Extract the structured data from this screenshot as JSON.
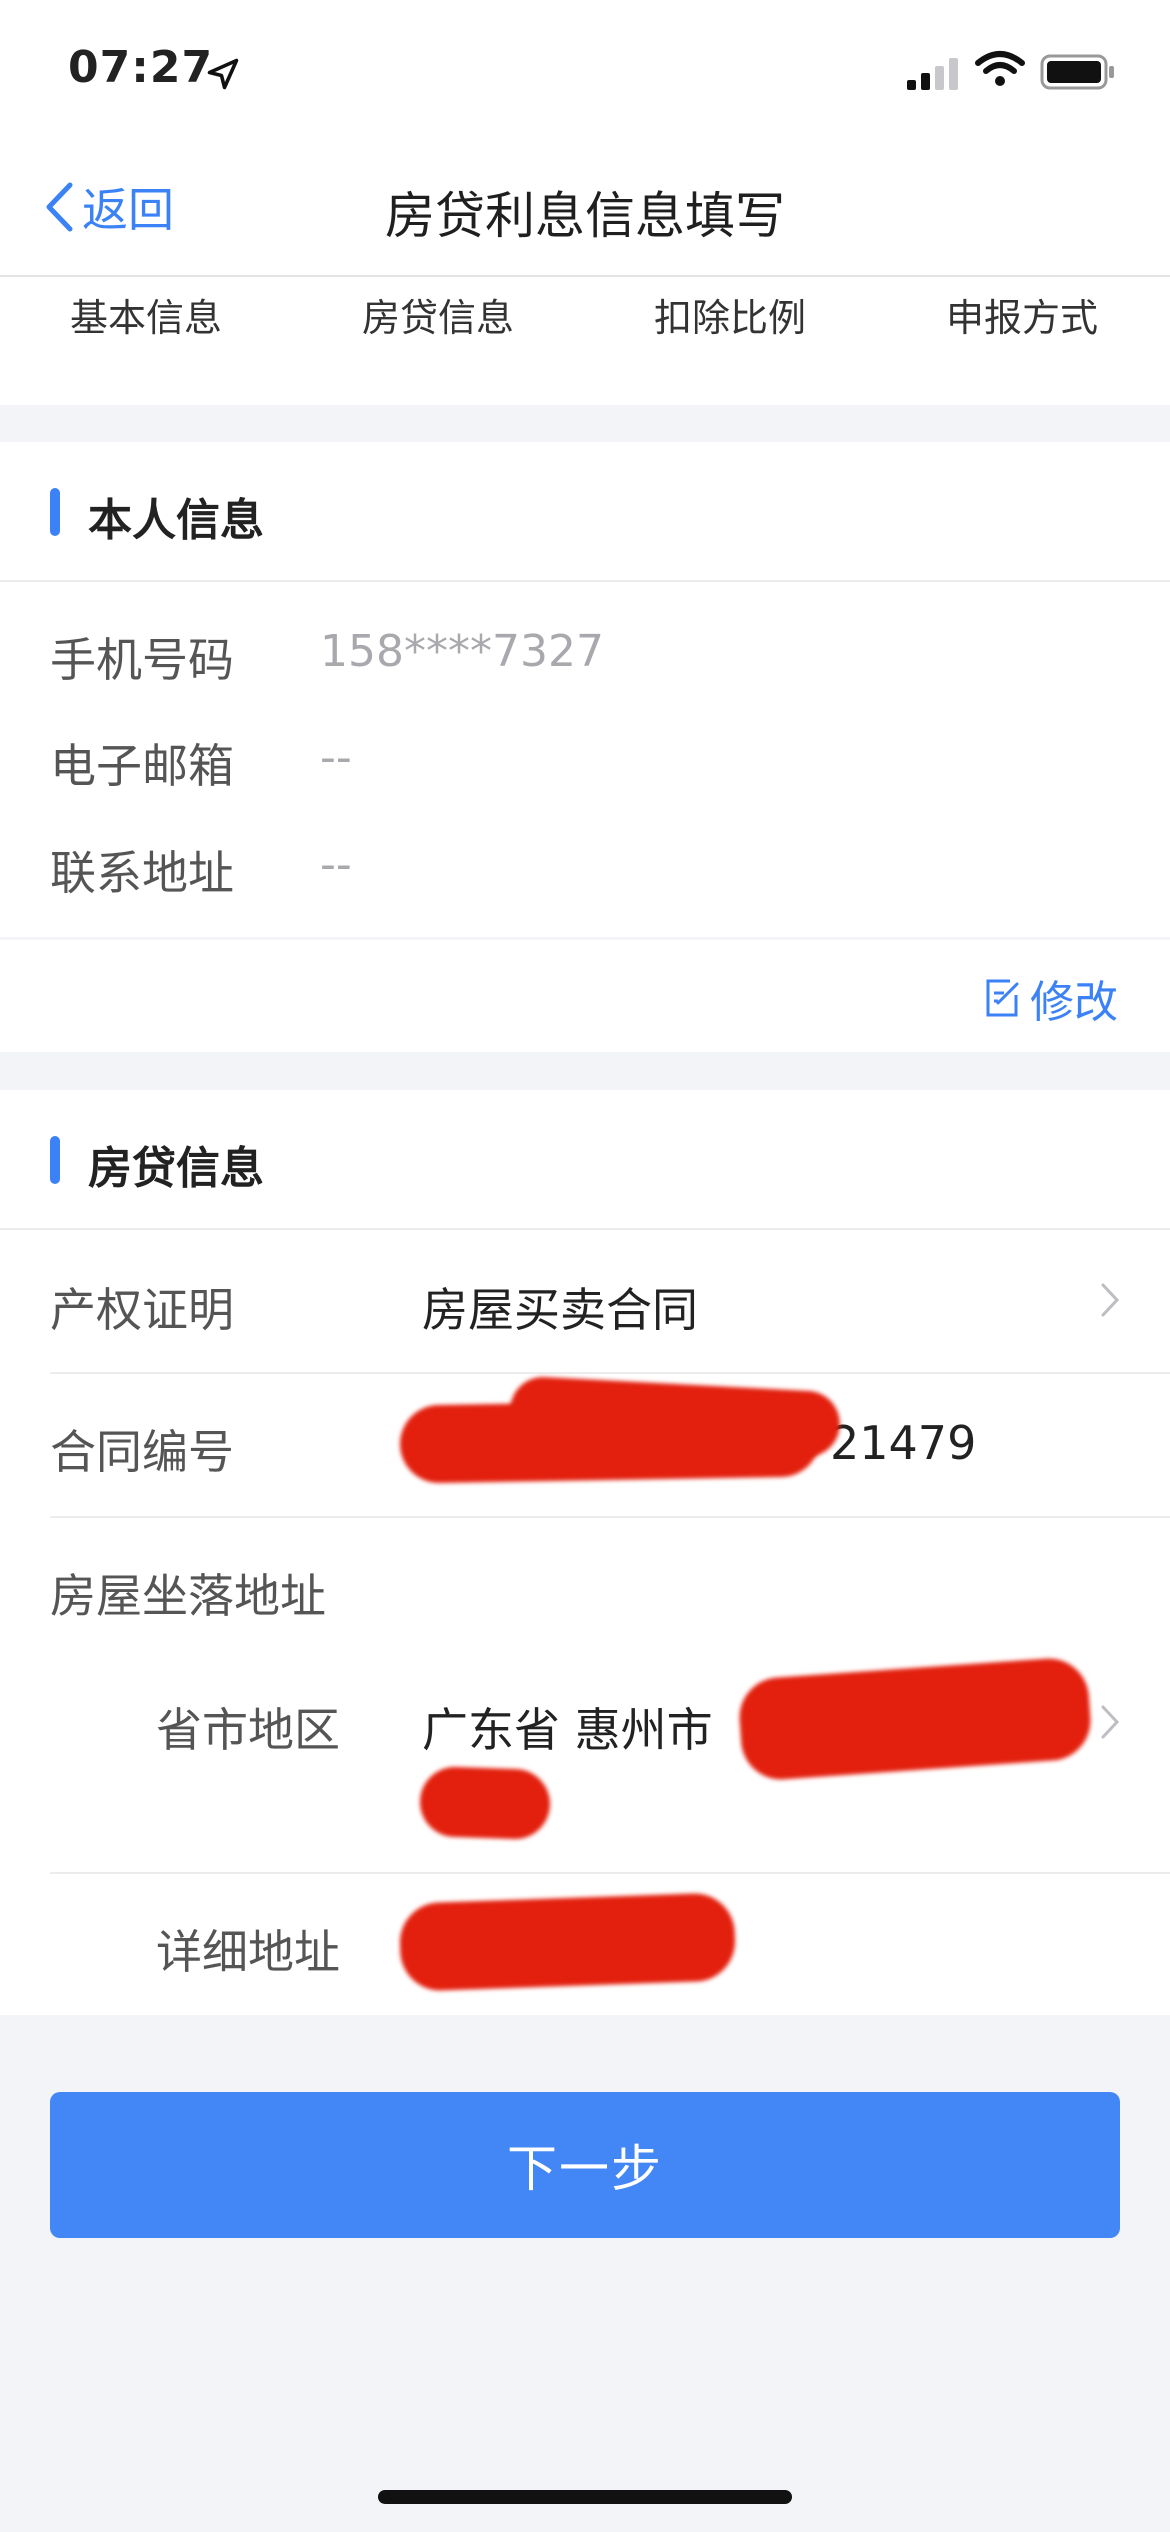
{
  "status_bar": {
    "time": "07:27"
  },
  "nav": {
    "back_label": "返回",
    "title": "房贷利息信息填写"
  },
  "steps": [
    "基本信息",
    "房贷信息",
    "扣除比例",
    "申报方式"
  ],
  "personal_info": {
    "section_title": "本人信息",
    "rows": [
      {
        "label": "手机号码",
        "value": "158****7327"
      },
      {
        "label": "电子邮箱",
        "value": "--"
      },
      {
        "label": "联系地址",
        "value": "--"
      }
    ],
    "edit_label": "修改"
  },
  "loan_info": {
    "section_title": "房贷信息",
    "property_proof": {
      "label": "产权证明",
      "value": "房屋买卖合同"
    },
    "contract_no": {
      "label": "合同编号",
      "value_visible": "21479"
    },
    "address_heading": "房屋坐落地址",
    "region": {
      "label": "省市地区",
      "value_visible": "广东省 惠州市"
    },
    "detail_address": {
      "label": "详细地址"
    }
  },
  "next_button": "下一步",
  "colors": {
    "accent": "#3b82f6",
    "button": "#4287f5",
    "redaction": "#e3200e",
    "background": "#f3f4f8"
  }
}
